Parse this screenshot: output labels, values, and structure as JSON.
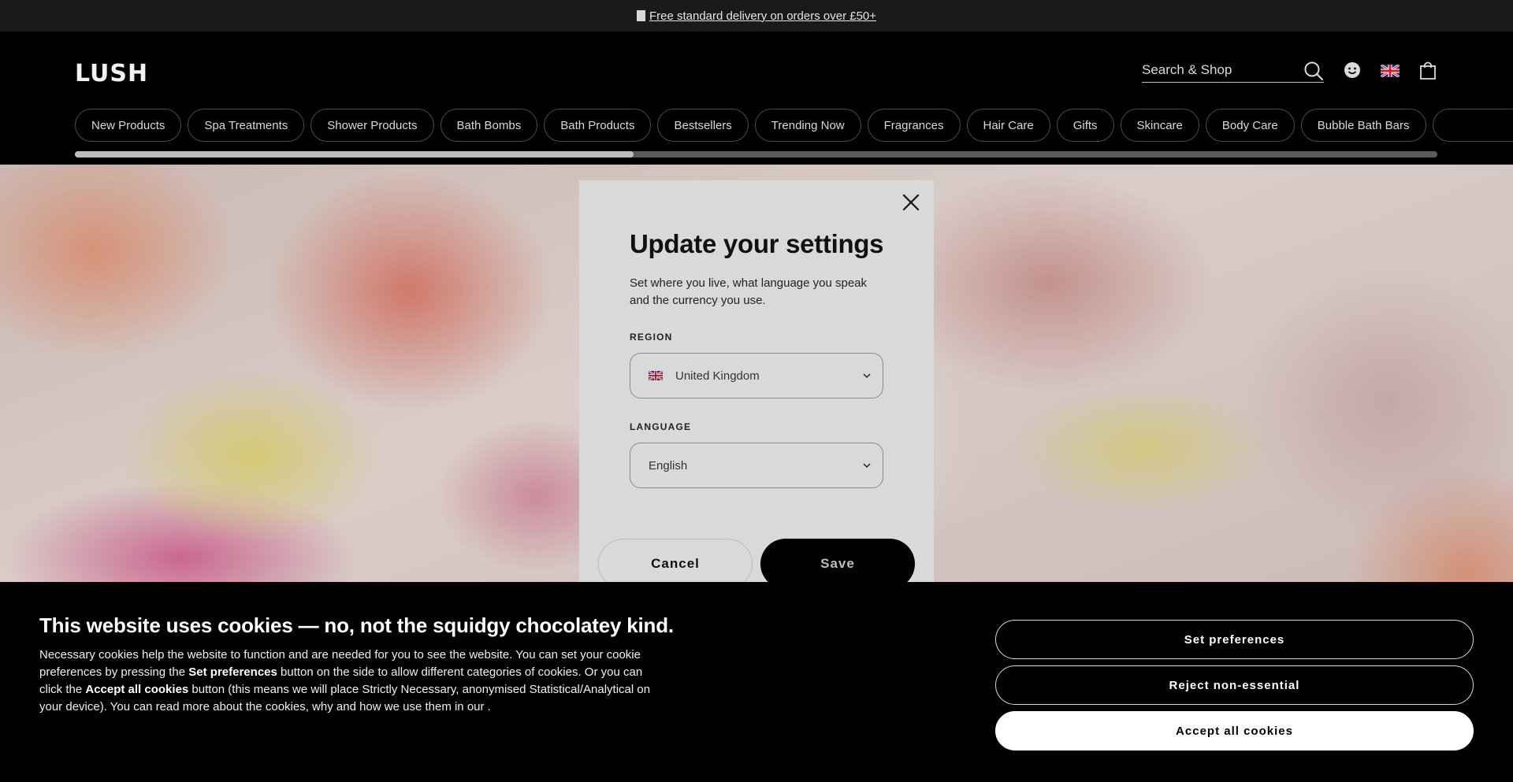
{
  "promo": {
    "text": "Free standard delivery on orders over £50+"
  },
  "header": {
    "logo": "LUSH",
    "search_placeholder": "Search & Shop"
  },
  "categories": [
    "New Products",
    "Spa Treatments",
    "Shower Products",
    "Bath Bombs",
    "Bath Products",
    "Bestsellers",
    "Trending Now",
    "Fragrances",
    "Hair Care",
    "Gifts",
    "Skincare",
    "Body Care",
    "Bubble Bath Bars"
  ],
  "category_scroll": {
    "visible_fraction": 0.41
  },
  "modal": {
    "title": "Update your settings",
    "intro": "Set where you live, what language you speak and the currency you use.",
    "region_label": "REGION",
    "region_value": "United Kingdom",
    "language_label": "LANGUAGE",
    "language_value": "English",
    "cancel_label": "Cancel",
    "save_label": "Save"
  },
  "cookie": {
    "title": "This website uses cookies — no, not the squidgy chocolatey kind.",
    "body_1": "Necessary cookies help the website to function and are needed for you to see the website. You can set your cookie preferences by pressing the ",
    "body_bold_1": "Set preferences",
    "body_2": " button on the side to allow different categories of cookies. Or you can click the ",
    "body_bold_2": "Accept all cookies",
    "body_3": " button (this means we will place Strictly Necessary, anonymised Statistical/Analytical on your device). You can read more about the cookies, why and how we use them in our .",
    "set_preferences": "Set preferences",
    "reject": "Reject non-essential",
    "accept": "Accept all cookies"
  },
  "colors": {
    "background": "#000000",
    "modal": "#d9d9d9",
    "promo": "#1a1a1a"
  },
  "icons": [
    "truck-icon",
    "search-icon",
    "account-icon",
    "uk-flag-icon",
    "bag-icon",
    "close-icon",
    "chevron-down-icon"
  ]
}
